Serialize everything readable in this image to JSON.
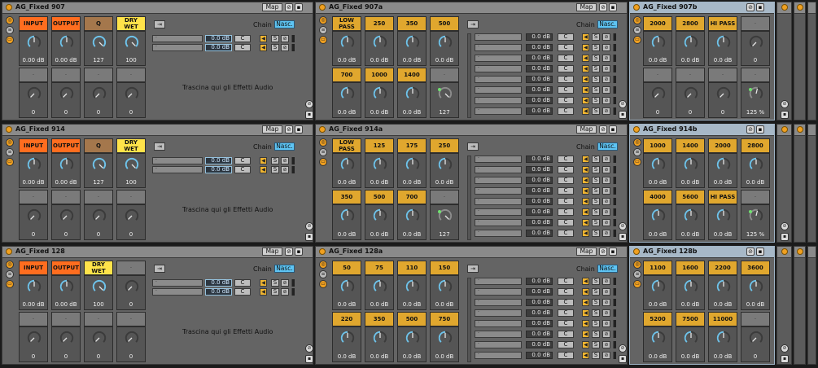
{
  "colors": {
    "accent_orange": "#ff6d1f",
    "gold": "#e0a72e",
    "yellow": "#ffe34a",
    "brown": "#a4774c",
    "knob_blue": "#6fc3ea",
    "nasc_blue": "#5ec4f3"
  },
  "common": {
    "map_label": "Map",
    "chain_label": "Chain",
    "nasc_label": "Nasc.",
    "drop_label": "Trascina qui gli Effetti Audio",
    "db_value": "0.0 dB",
    "c_label": "C",
    "s_label": "S",
    "dot": "·",
    "arrow_label": "⇥"
  },
  "rows": [
    {
      "rack": {
        "title": "AG_Fixed 907",
        "macros": [
          {
            "label": "INPUT",
            "color": "orange",
            "value": "0.00 dB",
            "active": true
          },
          {
            "label": "OUTPUT",
            "color": "orange",
            "value": "0.00 dB",
            "active": true
          },
          {
            "label": "Q",
            "color": "brown",
            "value": "127",
            "active": true
          },
          {
            "label": "DRY WET",
            "color": "yellow",
            "value": "100",
            "active": true
          },
          {
            "label": "·",
            "color": "grey",
            "value": "0",
            "active": false
          },
          {
            "label": "·",
            "color": "grey",
            "value": "0",
            "active": false
          },
          {
            "label": "·",
            "color": "grey",
            "value": "0",
            "active": false
          },
          {
            "label": "·",
            "color": "grey",
            "value": "0",
            "active": false
          }
        ]
      },
      "a": {
        "title": "AG_Fixed 907a",
        "macros": [
          {
            "label": "LOW PASS",
            "value": "0.0 dB",
            "active": true
          },
          {
            "label": "250",
            "value": "0.0 dB",
            "active": true
          },
          {
            "label": "350",
            "value": "0.0 dB",
            "active": true
          },
          {
            "label": "500",
            "value": "0.0 dB",
            "active": true
          },
          {
            "label": "700",
            "value": "0.0 dB",
            "active": true
          },
          {
            "label": "1000",
            "value": "0.0 dB",
            "active": true
          },
          {
            "label": "1400",
            "value": "0.0 dB",
            "active": true
          },
          {
            "label": "·",
            "value": "127",
            "active": false
          }
        ]
      },
      "b": {
        "title": "AG_Fixed 907b",
        "macros": [
          {
            "label": "2000",
            "value": "0.0 dB",
            "active": true
          },
          {
            "label": "2800",
            "value": "0.0 dB",
            "active": true
          },
          {
            "label": "HI PASS",
            "value": "0.0 dB",
            "active": true
          },
          {
            "label": "·",
            "value": "0",
            "active": false
          },
          {
            "label": "·",
            "value": "0",
            "active": false
          },
          {
            "label": "·",
            "value": "0",
            "active": false
          },
          {
            "label": "·",
            "value": "0",
            "active": false
          },
          {
            "label": "·",
            "value": "125 %",
            "active": false
          }
        ]
      }
    },
    {
      "rack": {
        "title": "AG_Fixed 914",
        "macros": [
          {
            "label": "INPUT",
            "color": "orange",
            "value": "0.00 dB",
            "active": true
          },
          {
            "label": "OUTPUT",
            "color": "orange",
            "value": "0.00 dB",
            "active": true
          },
          {
            "label": "Q",
            "color": "brown",
            "value": "127",
            "active": true
          },
          {
            "label": "DRY WET",
            "color": "yellow",
            "value": "100",
            "active": true
          },
          {
            "label": "·",
            "color": "grey",
            "value": "0",
            "active": false
          },
          {
            "label": "·",
            "color": "grey",
            "value": "0",
            "active": false
          },
          {
            "label": "·",
            "color": "grey",
            "value": "0",
            "active": false
          },
          {
            "label": "·",
            "color": "grey",
            "value": "0",
            "active": false
          }
        ]
      },
      "a": {
        "title": "AG_Fixed 914a",
        "macros": [
          {
            "label": "LOW PASS",
            "value": "0.0 dB",
            "active": true
          },
          {
            "label": "125",
            "value": "0.0 dB",
            "active": true
          },
          {
            "label": "175",
            "value": "0.0 dB",
            "active": true
          },
          {
            "label": "250",
            "value": "0.0 dB",
            "active": true
          },
          {
            "label": "350",
            "value": "0.0 dB",
            "active": true
          },
          {
            "label": "500",
            "value": "0.0 dB",
            "active": true
          },
          {
            "label": "700",
            "value": "0.0 dB",
            "active": true
          },
          {
            "label": "·",
            "value": "127",
            "active": false
          }
        ]
      },
      "b": {
        "title": "AG_Fixed 914b",
        "macros": [
          {
            "label": "1000",
            "value": "0.0 dB",
            "active": true
          },
          {
            "label": "1400",
            "value": "0.0 dB",
            "active": true
          },
          {
            "label": "2000",
            "value": "0.0 dB",
            "active": true
          },
          {
            "label": "2800",
            "value": "0.0 dB",
            "active": true
          },
          {
            "label": "4000",
            "value": "0.0 dB",
            "active": true
          },
          {
            "label": "5600",
            "value": "0.0 dB",
            "active": true
          },
          {
            "label": "HI PASS",
            "value": "0.0 dB",
            "active": true
          },
          {
            "label": "·",
            "value": "125 %",
            "active": false
          }
        ]
      }
    },
    {
      "rack": {
        "title": "AG_Fixed 128",
        "macros": [
          {
            "label": "INPUT",
            "color": "orange",
            "value": "0.00 dB",
            "active": true
          },
          {
            "label": "OUTPUT",
            "color": "orange",
            "value": "0.00 dB",
            "active": true
          },
          {
            "label": "DRY WET",
            "color": "yellow",
            "value": "100",
            "active": true
          },
          {
            "label": "·",
            "color": "grey",
            "value": "0",
            "active": false
          },
          {
            "label": "·",
            "color": "grey",
            "value": "0",
            "active": false
          },
          {
            "label": "·",
            "color": "grey",
            "value": "0",
            "active": false
          },
          {
            "label": "·",
            "color": "grey",
            "value": "0",
            "active": false
          },
          {
            "label": "·",
            "color": "grey",
            "value": "0",
            "active": false
          }
        ]
      },
      "a": {
        "title": "AG_Fixed 128a",
        "macros": [
          {
            "label": "50",
            "value": "0.0 dB",
            "active": true
          },
          {
            "label": "75",
            "value": "0.0 dB",
            "active": true
          },
          {
            "label": "110",
            "value": "0.0 dB",
            "active": true
          },
          {
            "label": "150",
            "value": "0.0 dB",
            "active": true
          },
          {
            "label": "220",
            "value": "0.0 dB",
            "active": true
          },
          {
            "label": "350",
            "value": "0.0 dB",
            "active": true
          },
          {
            "label": "500",
            "value": "0.0 dB",
            "active": true
          },
          {
            "label": "750",
            "value": "0.0 dB",
            "active": true
          }
        ]
      },
      "b": {
        "title": "AG_Fixed 128b",
        "macros": [
          {
            "label": "1100",
            "value": "0.0 dB",
            "active": true
          },
          {
            "label": "1600",
            "value": "0.0 dB",
            "active": true
          },
          {
            "label": "2200",
            "value": "0.0 dB",
            "active": true
          },
          {
            "label": "3600",
            "value": "0.0 dB",
            "active": true
          },
          {
            "label": "5200",
            "value": "0.0 dB",
            "active": true
          },
          {
            "label": "7500",
            "value": "0.0 dB",
            "active": true
          },
          {
            "label": "11000",
            "value": "0.0 dB",
            "active": true
          },
          {
            "label": "·",
            "value": "0",
            "active": false
          }
        ]
      }
    }
  ]
}
